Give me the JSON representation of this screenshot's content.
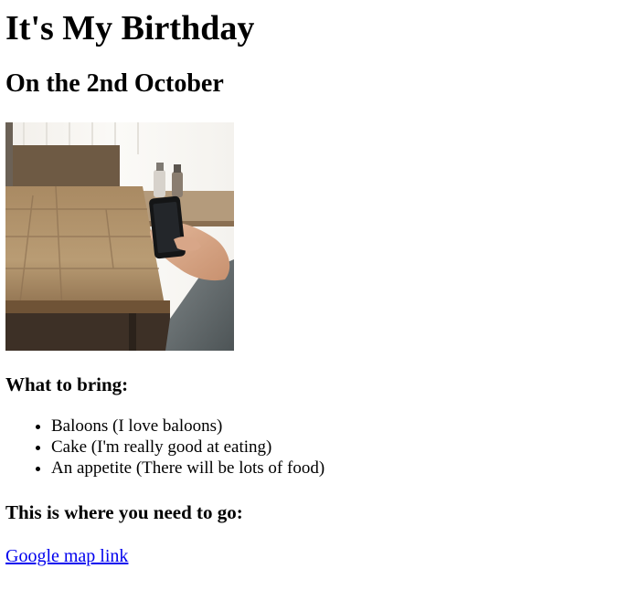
{
  "heading": "It's My Birthday",
  "subheading": "On the 2nd October",
  "bring_heading": "What to bring:",
  "bring_items": [
    "Baloons (I love baloons)",
    "Cake (I'm really good at eating)",
    "An appetite (There will be lots of food)"
  ],
  "go_heading": "This is where you need to go:",
  "map_link": "Google map link",
  "colors": {
    "link": "#0000ee",
    "text": "#000000",
    "background": "#ffffff"
  }
}
